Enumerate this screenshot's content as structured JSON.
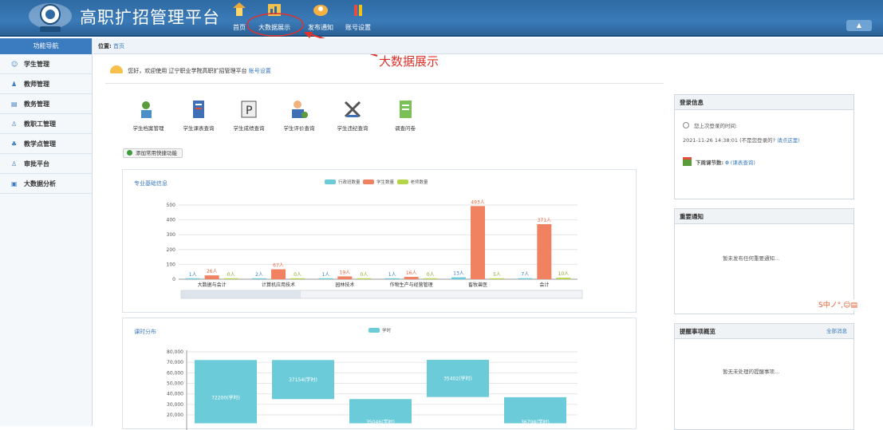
{
  "header": {
    "app_title": "高职扩招管理平台",
    "nav": [
      "首页",
      "大数据展示",
      "发布通知",
      "账号设置"
    ],
    "user_label": "▲"
  },
  "sidebar": {
    "title": "功能导航",
    "items": [
      "学生管理",
      "教师管理",
      "教务管理",
      "教职工管理",
      "教学点管理",
      "审批平台",
      "大数据分析"
    ]
  },
  "breadcrumb": {
    "label": "位置:",
    "current": "首页"
  },
  "annotation": "大数据展示",
  "welcome": {
    "text": "您好，欢迎使用 辽宁职业学院高职扩招管理平台",
    "link": "帐号设置"
  },
  "quick_icons": [
    "学生档案管理",
    "学生课表查询",
    "学生成绩查询",
    "学生评价查询",
    "学生违纪查询",
    "调查问卷"
  ],
  "add_function": "添加常用快捷功能",
  "colors": {
    "teal": "#6ccbd9",
    "salmon": "#f08262",
    "green": "#b5d449",
    "blue": "#3b7bbf"
  },
  "chart_data": [
    {
      "type": "bar",
      "title": "专业基础信息",
      "categories": [
        "大数据与会计",
        "计算机应用技术",
        "园林技术",
        "作物生产与经营管理",
        "畜牧兽医",
        "会计"
      ],
      "series": [
        {
          "name": "行政班数量",
          "values": [
            1,
            2,
            1,
            1,
            13,
            7
          ],
          "labels": [
            "1人",
            "2人",
            "1人",
            "1人",
            "13人",
            "7人"
          ]
        },
        {
          "name": "学生数量",
          "values": [
            26,
            67,
            19,
            16,
            493,
            371
          ],
          "labels": [
            "26人",
            "67人",
            "19人",
            "16人",
            "493人",
            "371人"
          ]
        },
        {
          "name": "老师数量",
          "values": [
            0,
            0,
            0,
            0,
            5,
            10
          ],
          "labels": [
            "0人",
            "0人",
            "0人",
            "0人",
            "5人",
            "10人"
          ]
        }
      ],
      "yticks": [
        "500",
        "400",
        "300",
        "200",
        "100",
        "0"
      ],
      "ylim": [
        0,
        500
      ]
    },
    {
      "type": "bar",
      "title": "课时分布",
      "legend": "学时",
      "bars": [
        {
          "low": 0,
          "high": 72200,
          "label": "72200(学时)"
        },
        {
          "low": 35000,
          "high": 72200,
          "label": "37154(学时)"
        },
        {
          "low": 0,
          "high": 35046,
          "label": "35046(学时)"
        },
        {
          "low": 37000,
          "high": 72400,
          "label": "35402(学时)"
        },
        {
          "low": 0,
          "high": 36798,
          "label": "36798(学时)"
        }
      ],
      "yticks": [
        "80,000",
        "70,000",
        "60,000",
        "50,000",
        "40,000",
        "30,000",
        "20,000"
      ],
      "ylim": [
        17000,
        80000
      ]
    }
  ],
  "login_info": {
    "title": "登录信息",
    "last_login_label": "您上次登录的时间:",
    "last_login_time": "2021-11-26 14:38:01",
    "not_you": "(不是您登录的?",
    "click_here": "请点这里)",
    "next_week_label": "下周课节数:",
    "next_week_count": "0",
    "schedule_link": "(课表查询)"
  },
  "notice": {
    "title": "重要通知",
    "empty": "暂未发布任何重要通知..."
  },
  "reminders": {
    "title": "提醒事项概览",
    "more": "全部消息",
    "empty": "暂无未处理的提醒事项..."
  },
  "ime": "S中ノ°,☺▤"
}
